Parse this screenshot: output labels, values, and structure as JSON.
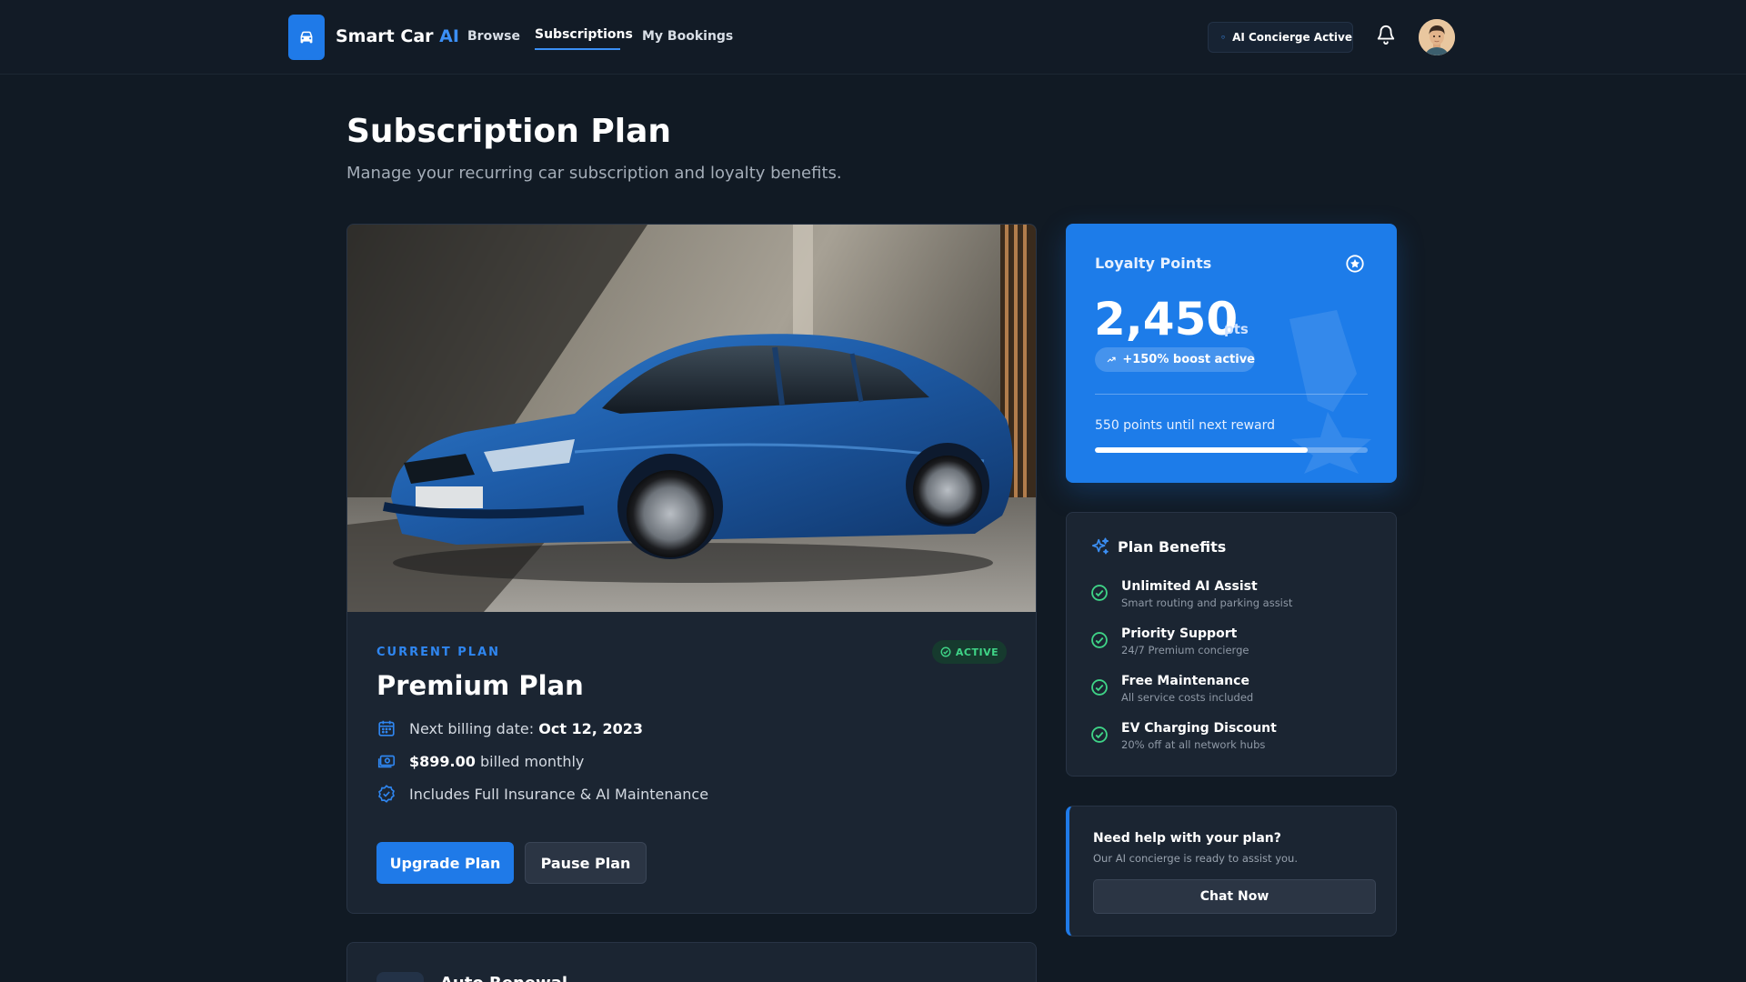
{
  "nav": {
    "brand": "Smart Car",
    "brand_ai": "AI",
    "links": [
      {
        "label": "Browse"
      },
      {
        "label": "Subscriptions"
      },
      {
        "label": "My Bookings"
      }
    ],
    "concierge_status": "AI Concierge Active",
    "icons": {
      "logo": "car-icon",
      "concierge": "shield-icon",
      "notifications": "bell-icon",
      "avatar": "user-avatar"
    }
  },
  "header": {
    "title": "Subscription Plan",
    "subtitle": "Manage your recurring car subscription and loyalty benefits."
  },
  "plan": {
    "image": "blue-sedan-photo",
    "label": "CURRENT PLAN",
    "status": "ACTIVE",
    "name": "Premium Plan",
    "billing_prefix": "Next billing date: ",
    "billing_date": "Oct 12, 2023",
    "price": "$899.00",
    "price_suffix": " billed monthly",
    "includes": "Includes Full Insurance & AI Maintenance",
    "upgrade_label": "Upgrade Plan",
    "pause_label": "Pause Plan",
    "icons": {
      "billing": "calendar-icon",
      "price": "cash-icon",
      "includes": "badge-check-icon"
    }
  },
  "next_section": {
    "title": "Auto Renewal"
  },
  "loyalty": {
    "title": "Loyalty Points",
    "points": "2,450",
    "unit": "pts",
    "boost": "+150% boost active",
    "next_reward": "550 points until next reward",
    "progress": 0.78,
    "colors": {
      "card": "#1d7ce9"
    },
    "icons": {
      "star": "star-circle-icon",
      "trend": "trending-up-icon",
      "watermark": "ribbon-icon"
    }
  },
  "benefits": {
    "title": "Plan Benefits",
    "items": [
      {
        "title": "Unlimited AI Assist",
        "desc": "Smart routing and parking assist"
      },
      {
        "title": "Priority Support",
        "desc": "24/7 Premium concierge"
      },
      {
        "title": "Free Maintenance",
        "desc": "All service costs included"
      },
      {
        "title": "EV Charging Discount",
        "desc": "20% off at all network hubs"
      }
    ],
    "colors": {
      "check": "#3fd487",
      "sparkle": "#3b8ff5"
    }
  },
  "help": {
    "title": "Need help with your plan?",
    "desc": "Our AI concierge is ready to assist you.",
    "button": "Chat Now"
  }
}
